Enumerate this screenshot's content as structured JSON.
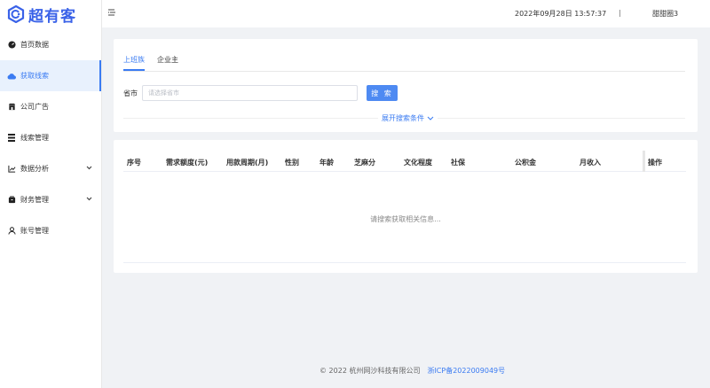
{
  "brand": {
    "name": "超有客",
    "color": "#3a62e8"
  },
  "accent": "#3a7bf2",
  "sidebar": {
    "items": [
      {
        "label": "首页数据",
        "icon": "dashboard-icon"
      },
      {
        "label": "获取线索",
        "icon": "cloud-icon",
        "active": true
      },
      {
        "label": "公司广告",
        "icon": "store-icon"
      },
      {
        "label": "线索管理",
        "icon": "list-icon"
      },
      {
        "label": "数据分析",
        "icon": "chart-icon",
        "expandable": true
      },
      {
        "label": "财务管理",
        "icon": "wallet-icon",
        "expandable": true
      },
      {
        "label": "账号管理",
        "icon": "user-icon"
      }
    ]
  },
  "topbar": {
    "menu_icon": "hamburger-icon",
    "datetime": "2022年09月28日 13:57:37",
    "separator": "|",
    "username": "甜甜圈3"
  },
  "search": {
    "tabs": [
      {
        "label": "上班族",
        "active": true
      },
      {
        "label": "企业主"
      }
    ],
    "province_label": "省市",
    "province_placeholder": "请选择省市",
    "province_value": "",
    "search_button": "搜 索",
    "expand_label": "展开搜索条件"
  },
  "table": {
    "columns": [
      "序号",
      "需求额度(元)",
      "用款周期(月)",
      "性别",
      "年龄",
      "芝麻分",
      "文化程度",
      "社保",
      "公积金",
      "月收入",
      "操作"
    ],
    "rows": [],
    "empty_text": "请搜索获取相关信息..."
  },
  "footer": {
    "copyright": "© 2022 杭州网沙科技有限公司",
    "icp": "浙ICP备2022009049号"
  }
}
